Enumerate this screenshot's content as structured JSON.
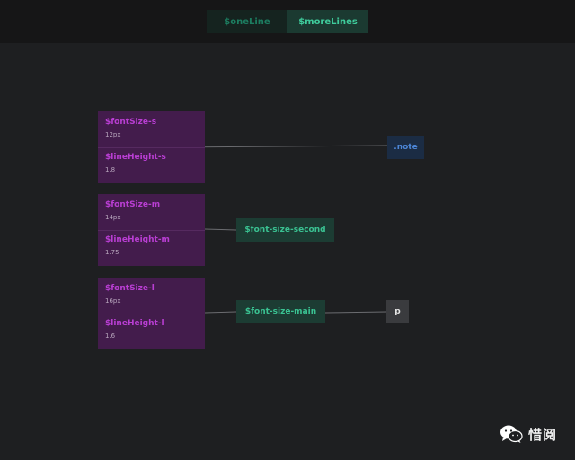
{
  "tabs": [
    {
      "label": "$oneLine",
      "active": false
    },
    {
      "label": "$moreLines",
      "active": true
    }
  ],
  "groups": [
    {
      "vars": [
        {
          "name": "$fontSize-s",
          "value": "12px"
        },
        {
          "name": "$lineHeight-s",
          "value": "1.8"
        }
      ]
    },
    {
      "vars": [
        {
          "name": "$fontSize-m",
          "value": "14px"
        },
        {
          "name": "$lineHeight-m",
          "value": "1.75"
        }
      ]
    },
    {
      "vars": [
        {
          "name": "$fontSize-l",
          "value": "16px"
        },
        {
          "name": "$lineHeight-l",
          "value": "1.6"
        }
      ]
    }
  ],
  "nodes": {
    "note": ".note",
    "second": "$font-size-second",
    "main": "$font-size-main",
    "p": "p"
  },
  "watermark": {
    "icon": "wechat-icon",
    "text": "惜阅"
  },
  "colors": {
    "variable_group": "#431c4c",
    "variable_name": "#b93ed3",
    "mixin_node": "#1c3c33",
    "mixin_text": "#3ac292",
    "selector_node": "#1b2c44",
    "selector_text": "#4c86d8",
    "element_node": "#3a3b3e",
    "link": "#6b6c70"
  }
}
